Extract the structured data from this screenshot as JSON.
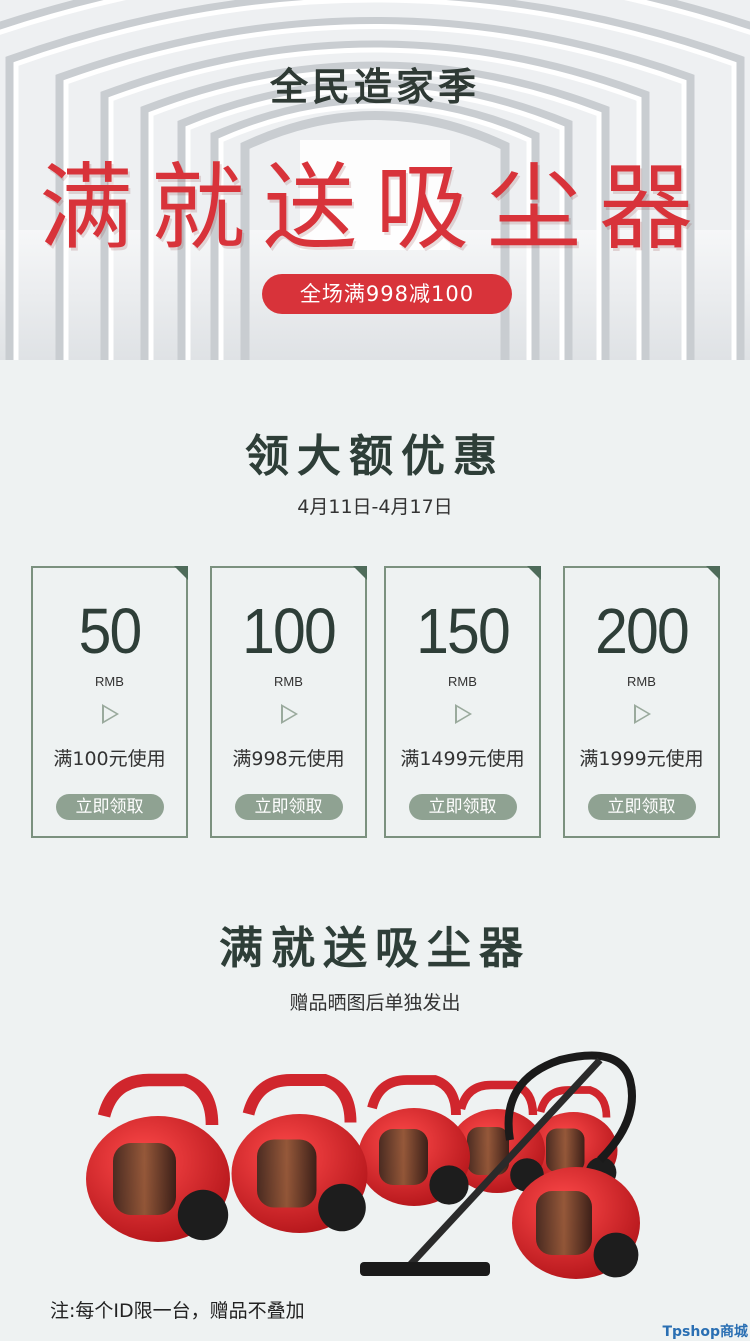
{
  "banner": {
    "event_name": "全民造家季",
    "headline": "满就送吸尘器",
    "promo": "全场满998减100"
  },
  "coupons_section": {
    "title": "领大额优惠",
    "date_range": "4月11日-4月17日",
    "coupons": [
      {
        "amount": "50",
        "currency": "RMB",
        "condition": "满100元使用",
        "button": "立即领取"
      },
      {
        "amount": "100",
        "currency": "RMB",
        "condition": "满998元使用",
        "button": "立即领取"
      },
      {
        "amount": "150",
        "currency": "RMB",
        "condition": "满1499元使用",
        "button": "立即领取"
      },
      {
        "amount": "200",
        "currency": "RMB",
        "condition": "满1999元使用",
        "button": "立即领取"
      }
    ]
  },
  "gift_section": {
    "title": "满就送吸尘器",
    "subtitle": "赠品晒图后单独发出",
    "note": "注:每个ID限一台，赠品不叠加"
  },
  "watermark": "Tpshop商城",
  "colors": {
    "accent_red": "#d8333a",
    "dark_green": "#2e3e38",
    "sage": "#8fa292",
    "border_green": "#7b917f"
  }
}
